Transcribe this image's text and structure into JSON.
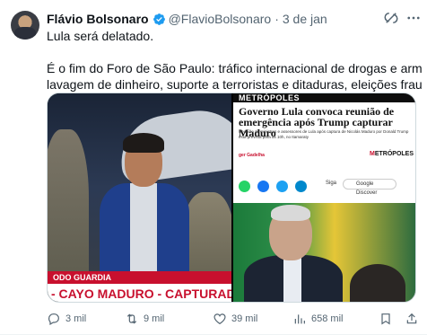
{
  "tweet": {
    "author_name": "Flávio Bolsonaro",
    "author_handle": "@FlavioBolsonaro",
    "separator": "·",
    "time": "3 de jan",
    "text_line1": "Lula será delatado.",
    "text_line2": "É o fim do Foro de São Paulo: tráfico internacional de drogas e armas,",
    "text_line3": "lavagem de dinheiro, suporte a terroristas e ditaduras, eleições fraudadas...",
    "brand_color": "#1d9bf0"
  },
  "media": {
    "left_image": {
      "banner_small": "ODO GUARDIA",
      "banner_large": "- CAYO MADURO - CAPTURADO!"
    },
    "right_image": {
      "outlet_top": "METRÓPOLES",
      "headline": "Governo Lula convoca reunião de emergência após Trump capturar Maduro",
      "subheadline": "Reunião de ministros e assessores de Lula após captura de Nicolás Maduro por Donald Trump está prevista para as 10h, no Itamaraty",
      "author": "ger Gadelha",
      "outlet_logo_prefix": "M",
      "outlet_logo_rest": "ETRÓPOLES",
      "follow_label": "Siga",
      "discover_label": "Google Discover"
    }
  },
  "actions": {
    "replies": "3 mil",
    "retweets": "9 mil",
    "likes": "39 mil",
    "views": "658 mil"
  },
  "icons": {
    "verified": "verified-badge-icon",
    "grok": "grok-icon",
    "more": "more-icon",
    "reply": "reply-icon",
    "retweet": "retweet-icon",
    "like": "heart-icon",
    "views": "views-icon",
    "bookmark": "bookmark-icon",
    "share": "share-icon"
  }
}
